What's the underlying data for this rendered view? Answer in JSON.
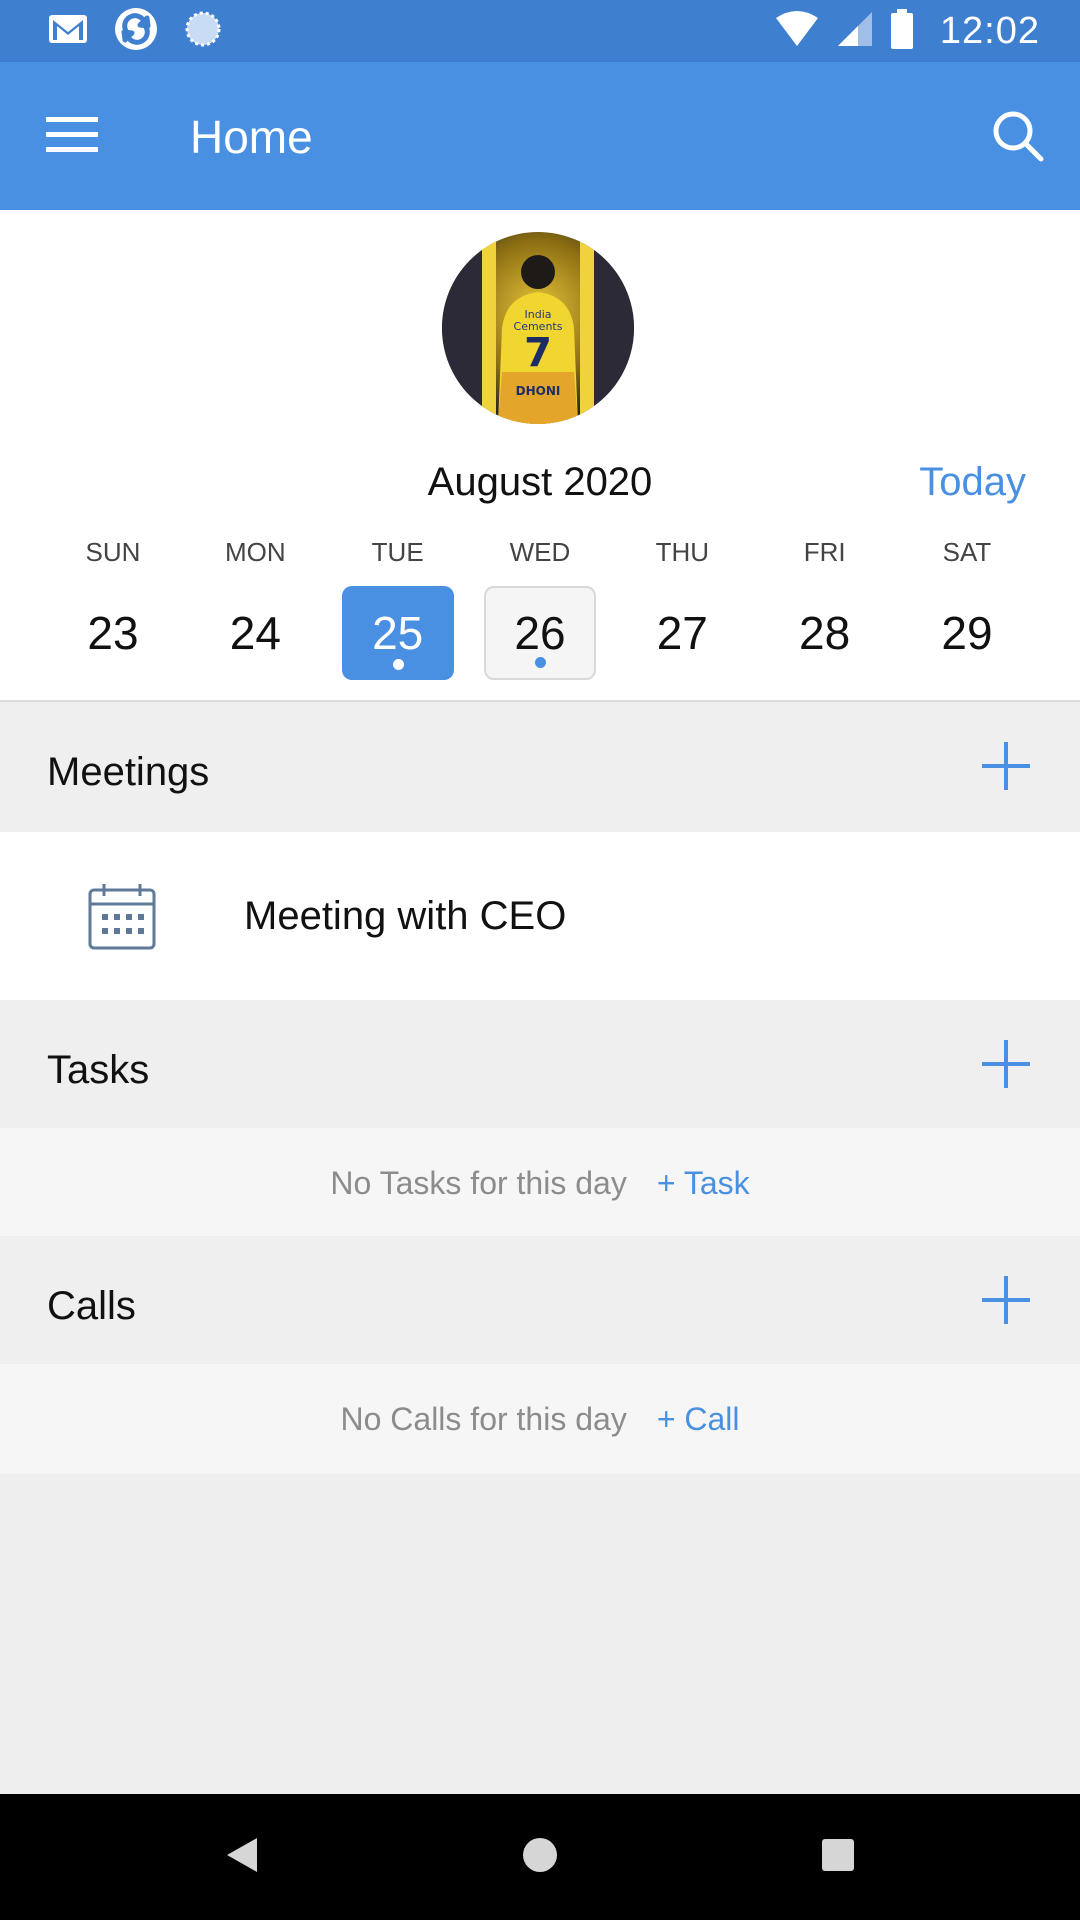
{
  "status_bar": {
    "time": "12:02",
    "left_icons": [
      "gmail-icon",
      "sync-app-icon",
      "loading-icon"
    ],
    "right_icons": [
      "wifi-icon",
      "cell-signal-icon",
      "battery-icon"
    ]
  },
  "app_bar": {
    "title": "Home",
    "menu_icon": "hamburger-menu-icon",
    "search_icon": "search-icon",
    "color": "#4a90e2"
  },
  "calendar": {
    "avatar_icon": "profile-avatar",
    "month_label": "August 2020",
    "today_label": "Today",
    "days": [
      {
        "name": "SUN",
        "date": "23",
        "state": "normal",
        "has_event": false
      },
      {
        "name": "MON",
        "date": "24",
        "state": "normal",
        "has_event": false
      },
      {
        "name": "TUE",
        "date": "25",
        "state": "selected",
        "has_event": true
      },
      {
        "name": "WED",
        "date": "26",
        "state": "current",
        "has_event": true
      },
      {
        "name": "THU",
        "date": "27",
        "state": "normal",
        "has_event": false
      },
      {
        "name": "FRI",
        "date": "28",
        "state": "normal",
        "has_event": false
      },
      {
        "name": "SAT",
        "date": "29",
        "state": "normal",
        "has_event": false
      }
    ]
  },
  "meetings": {
    "title": "Meetings",
    "items": [
      {
        "title": "Meeting with CEO",
        "icon": "calendar-icon"
      }
    ]
  },
  "tasks": {
    "title": "Tasks",
    "empty_text": "No Tasks for this day",
    "add_link": "+ Task"
  },
  "calls": {
    "title": "Calls",
    "empty_text": "No Calls for this day",
    "add_link": "+ Call"
  },
  "nav_bar": {
    "icons": [
      "back-icon",
      "home-icon",
      "recents-icon"
    ]
  }
}
